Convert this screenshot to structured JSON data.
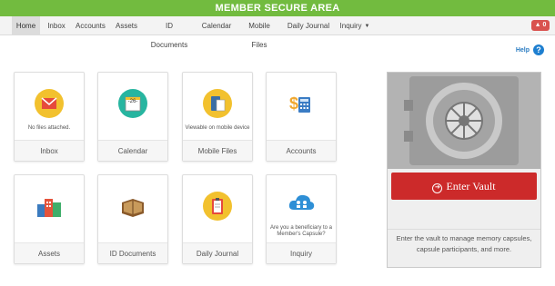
{
  "header": {
    "title": "MEMBER SECURE AREA"
  },
  "nav": {
    "items": [
      {
        "label": "Home",
        "active": true
      },
      {
        "label": "Inbox"
      },
      {
        "label": "Accounts"
      },
      {
        "label": "Assets"
      },
      {
        "label": "ID Documents"
      },
      {
        "label": "Calendar"
      },
      {
        "label": "Mobile Files"
      },
      {
        "label": "Daily Journal"
      },
      {
        "label": "Inquiry"
      }
    ],
    "alert_badge": "0"
  },
  "help": {
    "label": "Help",
    "icon": "question-circle-icon"
  },
  "tiles": [
    {
      "label": "Inbox",
      "note": "No files attached.",
      "icon": "envelope-icon",
      "color": "#f2c12e"
    },
    {
      "label": "Calendar",
      "note": "",
      "icon": "calendar-icon",
      "color": "#27b5a0",
      "icon_text": "-26-"
    },
    {
      "label": "Mobile Files",
      "note": "Viewable on mobile device",
      "icon": "mobile-files-icon",
      "color": "#f2c12e"
    },
    {
      "label": "Accounts",
      "note": "",
      "icon": "calculator-dollar-icon"
    },
    {
      "label": "Assets",
      "note": "",
      "icon": "buildings-icon"
    },
    {
      "label": "ID Documents",
      "note": "",
      "icon": "id-book-icon"
    },
    {
      "label": "Daily Journal",
      "note": "",
      "icon": "clipboard-icon",
      "color": "#f2c12e"
    },
    {
      "label": "Inquiry",
      "note": "Are you a beneficiary to a Member's Capsule?",
      "icon": "people-cloud-icon"
    }
  ],
  "vault": {
    "button_label": "Enter Vault",
    "description": "Enter the vault to manage memory capsules, capsule participants, and more.",
    "button_color": "#cc2a2a"
  },
  "colors": {
    "banner": "#72bb3f",
    "link": "#2a7cc2"
  }
}
